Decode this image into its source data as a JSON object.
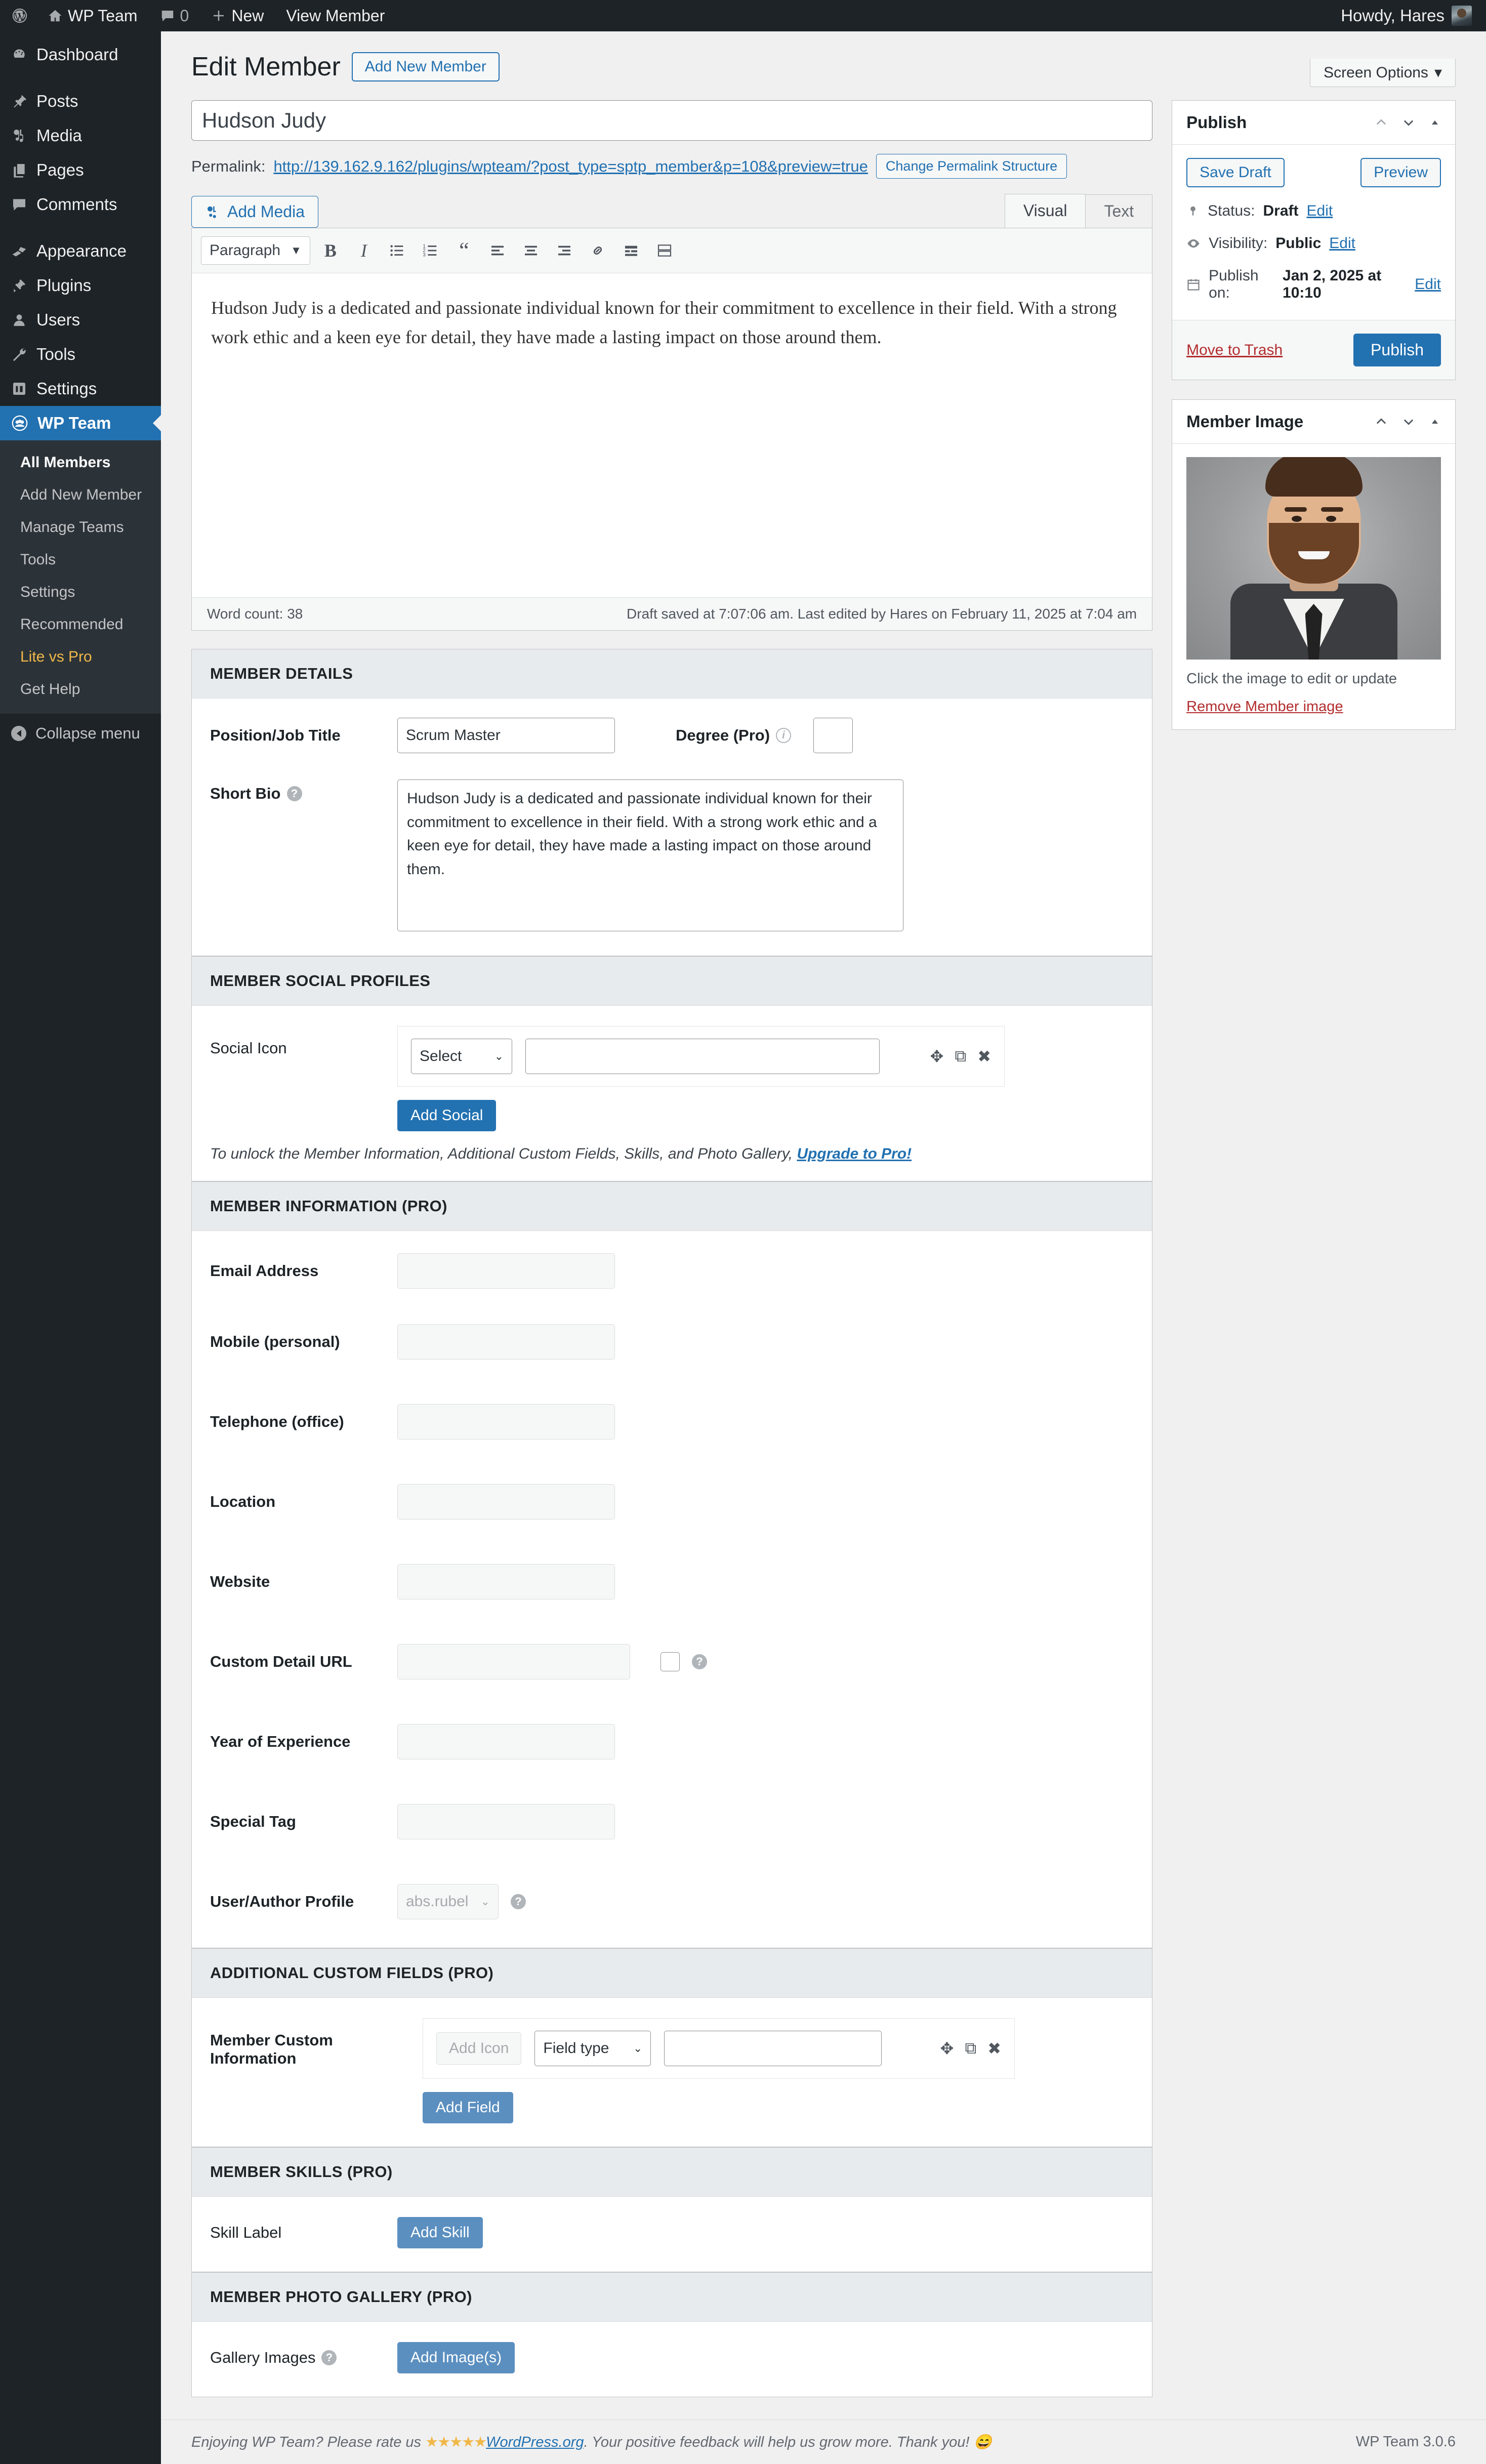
{
  "adminbar": {
    "site_name": "WP Team",
    "comments_count": "0",
    "new_label": "New",
    "view_member_label": "View Member",
    "howdy": "Howdy, Hares"
  },
  "sidebar": {
    "items": [
      {
        "label": "Dashboard",
        "icon": "dashboard-icon"
      },
      {
        "label": "Posts",
        "icon": "posts-icon"
      },
      {
        "label": "Media",
        "icon": "media-icon"
      },
      {
        "label": "Pages",
        "icon": "pages-icon"
      },
      {
        "label": "Comments",
        "icon": "comments-icon"
      },
      {
        "label": "Appearance",
        "icon": "appearance-icon"
      },
      {
        "label": "Plugins",
        "icon": "plugins-icon"
      },
      {
        "label": "Users",
        "icon": "users-icon"
      },
      {
        "label": "Tools",
        "icon": "tools-icon"
      },
      {
        "label": "Settings",
        "icon": "settings-icon"
      },
      {
        "label": "WP Team",
        "icon": "wpteam-icon"
      }
    ],
    "submenu": [
      {
        "label": "All Members",
        "state": "current"
      },
      {
        "label": "Add New Member",
        "state": "normal"
      },
      {
        "label": "Manage Teams",
        "state": "normal"
      },
      {
        "label": "Tools",
        "state": "normal"
      },
      {
        "label": "Settings",
        "state": "normal"
      },
      {
        "label": "Recommended",
        "state": "normal"
      },
      {
        "label": "Lite vs Pro",
        "state": "highlight"
      },
      {
        "label": "Get Help",
        "state": "normal"
      }
    ],
    "collapse_label": "Collapse menu"
  },
  "screen_options_label": "Screen Options",
  "page": {
    "title": "Edit Member",
    "add_new_button": "Add New Member",
    "member_title_value": "Hudson Judy",
    "permalink_label": "Permalink:",
    "permalink_url": "http://139.162.9.162/plugins/wpteam/?post_type=sptp_member&p=108&preview=true",
    "change_permalink_button": "Change Permalink Structure"
  },
  "editor": {
    "add_media_label": "Add Media",
    "tab_visual": "Visual",
    "tab_text": "Text",
    "format_select": "Paragraph",
    "toolbar_buttons": [
      "bold-icon",
      "italic-icon",
      "bulleted-list-icon",
      "numbered-list-icon",
      "blockquote-icon",
      "align-left-icon",
      "align-center-icon",
      "align-right-icon",
      "link-icon",
      "read-more-icon",
      "toolbar-toggle-icon"
    ],
    "content": "Hudson Judy is a dedicated and passionate individual known for their commitment to excellence in their field. With a strong work ethic and a keen eye for detail, they have made a lasting impact on those around them.",
    "word_count": "Word count: 38",
    "save_status": "Draft saved at 7:07:06 am. Last edited by Hares on February 11, 2025 at 7:04 am"
  },
  "publish_box": {
    "title": "Publish",
    "save_draft": "Save Draft",
    "preview": "Preview",
    "status_label": "Status:",
    "status_value": "Draft",
    "status_edit": "Edit",
    "visibility_label": "Visibility:",
    "visibility_value": "Public",
    "visibility_edit": "Edit",
    "publish_on_label": "Publish on:",
    "publish_on_value": "Jan 2, 2025 at 10:10",
    "publish_on_edit": "Edit",
    "move_to_trash": "Move to Trash",
    "publish_button": "Publish"
  },
  "member_image_box": {
    "title": "Member Image",
    "caption": "Click the image to edit or update",
    "remove_link": "Remove Member image"
  },
  "member_details": {
    "title": "MEMBER DETAILS",
    "position_label": "Position/Job Title",
    "position_value": "Scrum Master",
    "degree_label": "Degree (Pro)",
    "degree_value": "",
    "short_bio_label": "Short Bio",
    "short_bio_value": "Hudson Judy is a dedicated and passionate individual known for their commitment to excellence in their field. With a strong work ethic and a keen eye for detail, they have made a lasting impact on those around them."
  },
  "social_profiles": {
    "title": "MEMBER SOCIAL PROFILES",
    "social_icon_label": "Social Icon",
    "select_value": "Select",
    "url_value": "",
    "add_social_button": "Add Social",
    "upgrade_text_before": "To unlock the Member Information, Additional Custom Fields, Skills, and Photo Gallery, ",
    "upgrade_link": "Upgrade to Pro!"
  },
  "member_information": {
    "title": "MEMBER INFORMATION (PRO)",
    "fields": [
      {
        "label": "Email Address",
        "value": ""
      },
      {
        "label": "Mobile (personal)",
        "value": ""
      },
      {
        "label": "Telephone (office)",
        "value": ""
      },
      {
        "label": "Location",
        "value": ""
      },
      {
        "label": "Website",
        "value": ""
      }
    ],
    "custom_detail_url_label": "Custom Detail URL",
    "custom_detail_url_value": "",
    "year_of_experience_label": "Year of Experience",
    "year_of_experience_value": "",
    "special_tag_label": "Special Tag",
    "special_tag_value": "",
    "user_author_profile_label": "User/Author Profile",
    "user_author_profile_value": "abs.rubel"
  },
  "custom_fields": {
    "title": "ADDITIONAL CUSTOM FIELDS (PRO)",
    "row_label": "Member Custom Information",
    "add_icon_button": "Add Icon",
    "field_type_select": "Field type",
    "field_value": "",
    "add_field_button": "Add Field"
  },
  "skills": {
    "title": "MEMBER SKILLS (PRO)",
    "skill_label": "Skill Label",
    "add_skill_button": "Add Skill"
  },
  "gallery": {
    "title": "MEMBER PHOTO GALLERY (PRO)",
    "gallery_images_label": "Gallery Images",
    "add_images_button": "Add Image(s)"
  },
  "footer": {
    "text_before": "Enjoying WP Team? Please rate us ",
    "stars": "★★★★★",
    "link": "WordPress.org",
    "text_after": ". Your positive feedback will help us grow more. Thank you! 😄",
    "version": "WP Team 3.0.6"
  },
  "colors": {
    "accent": "#2271b1",
    "sidebar_bg": "#1d2327",
    "danger": "#b32d2e",
    "highlight": "#f0b849"
  }
}
